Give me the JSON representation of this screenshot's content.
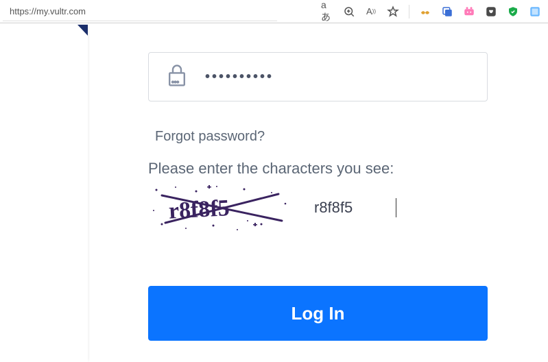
{
  "browser": {
    "url": "https://my.vultr.com",
    "actions": {
      "translate": "aあ",
      "zoom": "⊕",
      "read_aloud": "Aᴺ",
      "favorite": "☆"
    }
  },
  "form": {
    "password_masked": "••••••••••",
    "forgot_label": "Forgot password?",
    "captcha_prompt": "Please enter the characters you see:",
    "captcha_value": "r8f8f5",
    "captcha_image_text": "r8f8f5",
    "login_label": "Log In"
  }
}
